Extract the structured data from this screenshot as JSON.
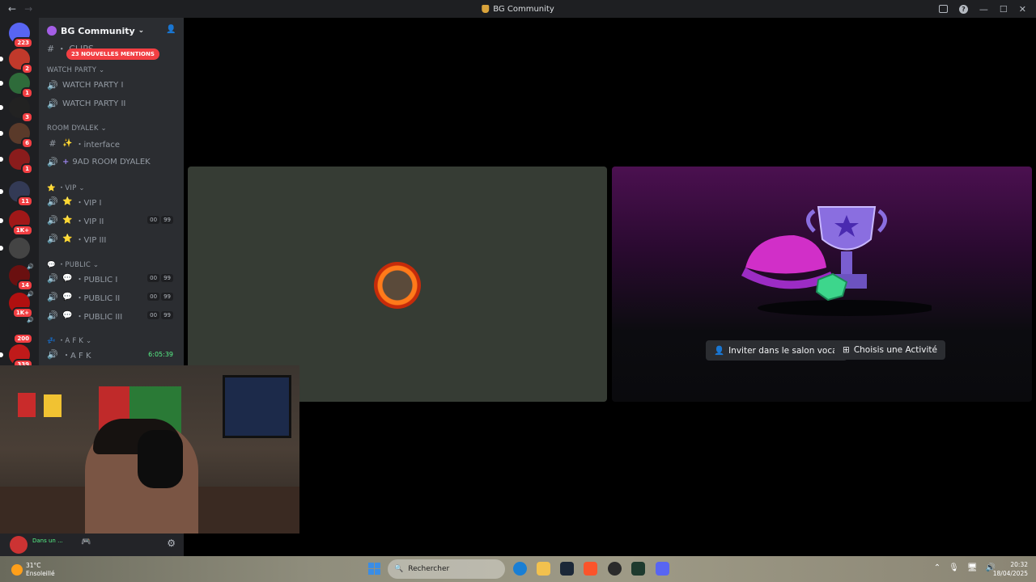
{
  "window": {
    "title": "BG Community",
    "nav_back": "←",
    "nav_forward": "→",
    "controls": {
      "minimize": "—",
      "maximize": "☐",
      "close": "✕",
      "help": "?"
    }
  },
  "server_rail": {
    "items": [
      {
        "badge": "223"
      },
      {
        "badge": "2"
      },
      {
        "badge": "1"
      },
      {
        "badge": "3"
      },
      {
        "badge": "6"
      },
      {
        "badge": "1"
      },
      {
        "badge": "11"
      },
      {
        "badge": "1K+"
      },
      {
        "badge": ""
      },
      {
        "badge": "14"
      },
      {
        "badge": "1K+"
      },
      {
        "badge": "200"
      },
      {
        "badge": "339"
      }
    ]
  },
  "sidebar": {
    "server_name": "BG Community",
    "server_chevron": "⌄",
    "mentions_pill": "23 NOUVELLES MENTIONS",
    "clip_channel": "・ CLIPS",
    "categories": {
      "watch_party": "WATCH PARTY",
      "room_dyalek": "ROOM DYALEK",
      "vip": "・VIP",
      "public": "・PUBLIC",
      "afk": "・A F K"
    },
    "channels": {
      "watch_party_1": "WATCH PARTY I",
      "watch_party_2": "WATCH PARTY II",
      "interface": "・interface",
      "room": "9AD ROOM DYALEK",
      "vip_1": "・VIP I",
      "vip_2": "・VIP II",
      "vip_3": "・VIP III",
      "public_1": "・PUBLIC I",
      "public_2": "・PUBLIC II",
      "public_3": "・PUBLIC III",
      "afk": "・A F K"
    },
    "counts": {
      "a": "00",
      "b": "99"
    },
    "afk_timer": "6:05:39",
    "user_status": "Dans un ..."
  },
  "stage": {
    "invite_button": "Inviter dans le salon vocal",
    "activity_button": "Choisis une Activité"
  },
  "taskbar": {
    "temperature": "31°C",
    "weather": "Ensoleillé",
    "search_placeholder": "Rechercher",
    "time": "20:32",
    "date": "18/04/2025"
  },
  "colors": {
    "accent_red": "#f23f43",
    "online_green": "#57f287",
    "sidebar_bg": "#2b2d31",
    "rail_bg": "#1e1f22"
  }
}
